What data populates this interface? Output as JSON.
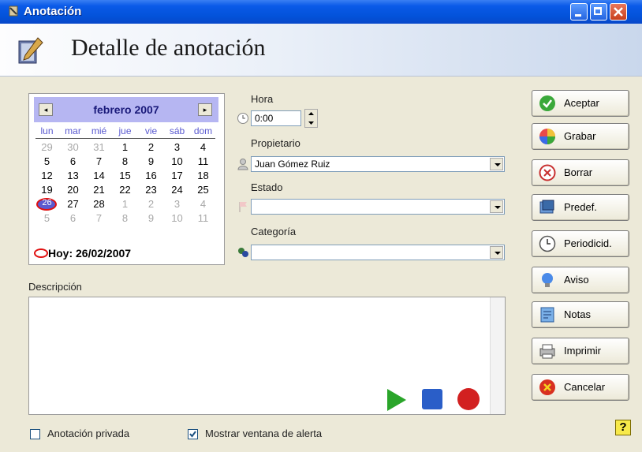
{
  "window": {
    "title": "Anotación"
  },
  "header": {
    "title": "Detalle de anotación"
  },
  "calendar": {
    "month": "febrero 2007",
    "weekdays": [
      "lun",
      "mar",
      "mié",
      "jue",
      "vie",
      "sáb",
      "dom"
    ],
    "weeks": [
      [
        "29",
        "30",
        "31",
        "1",
        "2",
        "3",
        "4"
      ],
      [
        "5",
        "6",
        "7",
        "8",
        "9",
        "10",
        "11"
      ],
      [
        "12",
        "13",
        "14",
        "15",
        "16",
        "17",
        "18"
      ],
      [
        "19",
        "20",
        "21",
        "22",
        "23",
        "24",
        "25"
      ],
      [
        "26",
        "27",
        "28",
        "1",
        "2",
        "3",
        "4"
      ],
      [
        "5",
        "6",
        "7",
        "8",
        "9",
        "10",
        "11"
      ]
    ],
    "today_label": "Hoy: 26/02/2007"
  },
  "fields": {
    "hora": {
      "label": "Hora",
      "value": "0:00"
    },
    "propietario": {
      "label": "Propietario",
      "value": "Juan Gómez Ruiz"
    },
    "estado": {
      "label": "Estado",
      "value": ""
    },
    "categoria": {
      "label": "Categoría",
      "value": ""
    },
    "descripcion": {
      "label": "Descripción",
      "value": ""
    }
  },
  "buttons": {
    "aceptar": "Aceptar",
    "grabar": "Grabar",
    "borrar": "Borrar",
    "predef": "Predef.",
    "periodicid": "Periodicid.",
    "aviso": "Aviso",
    "notas": "Notas",
    "imprimir": "Imprimir",
    "cancelar": "Cancelar",
    "help": "?"
  },
  "checkboxes": {
    "privada": {
      "label": "Anotación privada",
      "checked": false
    },
    "alerta": {
      "label": "Mostrar ventana de alerta",
      "checked": true
    }
  },
  "colors": {
    "titlebar": "#0a5ae8",
    "calendar_header": "#b6b6f2",
    "today_ring": "#e01010"
  }
}
